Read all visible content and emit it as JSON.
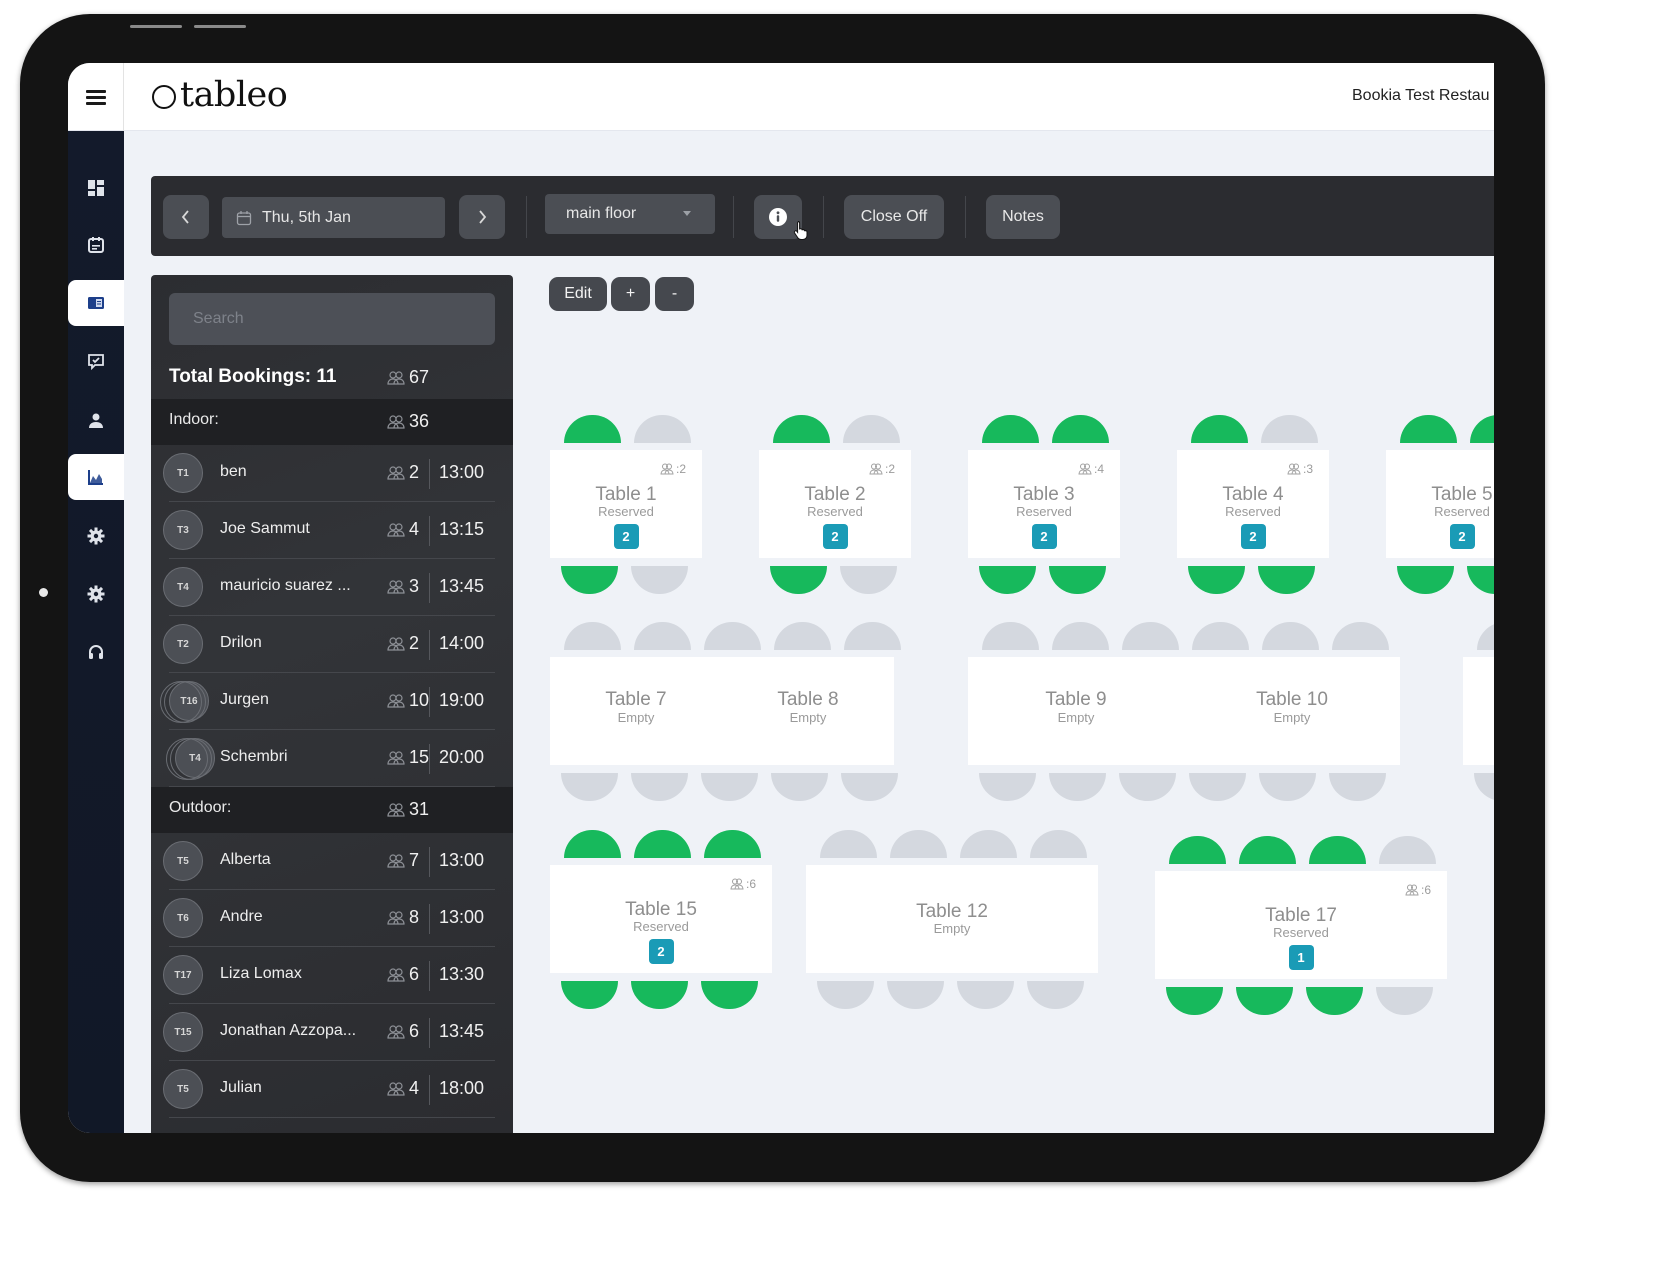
{
  "app": {
    "brand": "tableo",
    "restaurant": "Bookia Test Restau"
  },
  "nav": {
    "items": [
      {
        "id": "dashboard",
        "icon": "dashboard-icon",
        "active": false
      },
      {
        "id": "calendar",
        "icon": "calendar-icon",
        "active": false
      },
      {
        "id": "floor-plan",
        "icon": "floor-plan-icon",
        "active": true
      },
      {
        "id": "reviews",
        "icon": "chat-check-icon",
        "active": false
      },
      {
        "id": "guests",
        "icon": "person-icon",
        "active": false
      },
      {
        "id": "analytics",
        "icon": "chart-icon",
        "active": true
      },
      {
        "id": "settings",
        "icon": "gear-icon",
        "active": false
      },
      {
        "id": "settings-2",
        "icon": "gear-icon",
        "active": false
      },
      {
        "id": "support",
        "icon": "headset-icon",
        "active": false
      }
    ]
  },
  "toolbar": {
    "date": "Thu, 5th Jan",
    "floor": "main floor",
    "close_off": "Close Off",
    "notes": "Notes"
  },
  "bookings": {
    "search_placeholder": "Search",
    "total_label": "Total Bookings: 11",
    "total_covers": "67",
    "sections": [
      {
        "label": "Indoor:",
        "covers": "36",
        "rows": [
          {
            "table": "T1",
            "name": "ben",
            "covers": "2",
            "time": "13:00",
            "stack": 1
          },
          {
            "table": "T3",
            "name": "Joe Sammut",
            "covers": "4",
            "time": "13:15",
            "stack": 1
          },
          {
            "table": "T4",
            "name": "mauricio suarez ...",
            "covers": "3",
            "time": "13:45",
            "stack": 1
          },
          {
            "table": "T2",
            "name": "Drilon",
            "covers": "2",
            "time": "14:00",
            "stack": 1
          },
          {
            "table": "T16",
            "name": "Jurgen",
            "covers": "10",
            "time": "19:00",
            "stack": 2
          },
          {
            "table": "T4",
            "name": "Schembri",
            "covers": "15",
            "time": "20:00",
            "stack": 4
          }
        ]
      },
      {
        "label": "Outdoor:",
        "covers": "31",
        "rows": [
          {
            "table": "T5",
            "name": "Alberta",
            "covers": "7",
            "time": "13:00",
            "stack": 1
          },
          {
            "table": "T6",
            "name": "Andre",
            "covers": "8",
            "time": "13:00",
            "stack": 1
          },
          {
            "table": "T17",
            "name": "Liza Lomax",
            "covers": "6",
            "time": "13:30",
            "stack": 1
          },
          {
            "table": "T15",
            "name": "Jonathan Azzopa...",
            "covers": "6",
            "time": "13:45",
            "stack": 1
          },
          {
            "table": "T5",
            "name": "Julian",
            "covers": "4",
            "time": "18:00",
            "stack": 1
          }
        ]
      }
    ]
  },
  "floor_plan": {
    "edit": "Edit",
    "zoom_in": "+",
    "zoom_out": "-",
    "tables": [
      {
        "name": "Table 1",
        "status": "Reserved",
        "capacity": "2",
        "badge": "2"
      },
      {
        "name": "Table 2",
        "status": "Reserved",
        "capacity": "2",
        "badge": "2"
      },
      {
        "name": "Table 3",
        "status": "Reserved",
        "capacity": "4",
        "badge": "2"
      },
      {
        "name": "Table 4",
        "status": "Reserved",
        "capacity": "3",
        "badge": "2"
      },
      {
        "name": "Table 5",
        "status": "Reserved",
        "capacity": "",
        "badge": "2"
      },
      {
        "name": "Table 7",
        "status": "Empty"
      },
      {
        "name": "Table 8",
        "status": "Empty"
      },
      {
        "name": "Table 9",
        "status": "Empty"
      },
      {
        "name": "Table 10",
        "status": "Empty"
      },
      {
        "name": "Table 15",
        "status": "Reserved",
        "capacity": "6",
        "badge": "2"
      },
      {
        "name": "Table 12",
        "status": "Empty"
      },
      {
        "name": "Table 17",
        "status": "Reserved",
        "capacity": "6",
        "badge": "1"
      }
    ]
  },
  "colors": {
    "seat_taken": "#17b95c",
    "seat_free": "#d4d8df",
    "badge": "#1a9bb6",
    "toolbar": "#2b2c30",
    "rail": "#131a2b"
  }
}
